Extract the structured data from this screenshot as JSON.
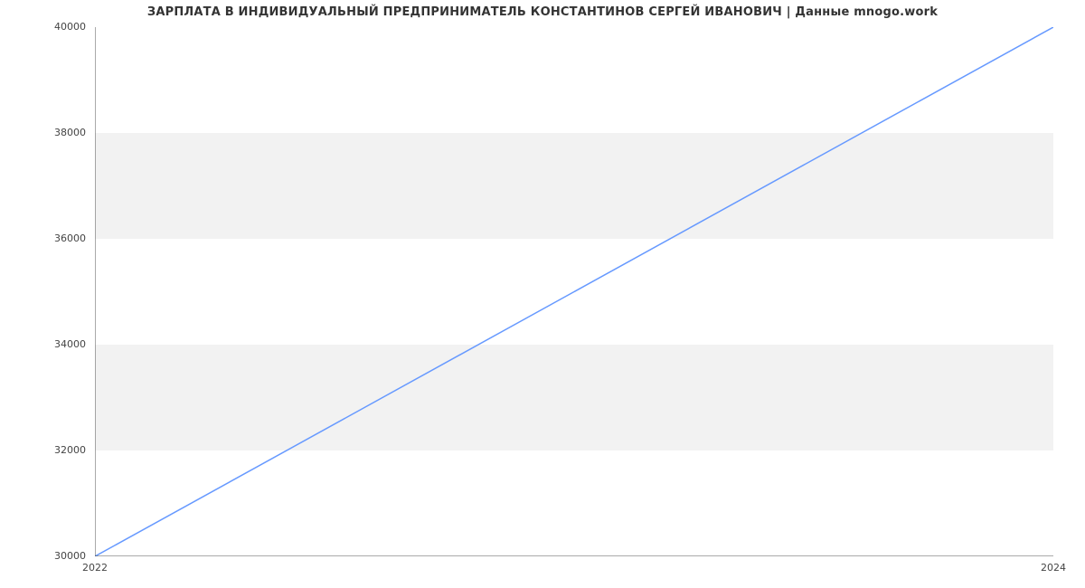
{
  "chart_data": {
    "type": "line",
    "title": "ЗАРПЛАТА В ИНДИВИДУАЛЬНЫЙ ПРЕДПРИНИМАТЕЛЬ КОНСТАНТИНОВ СЕРГЕЙ ИВАНОВИЧ | Данные mnogo.work",
    "x": [
      2022,
      2024
    ],
    "values": [
      30000,
      40000
    ],
    "xlabel": "",
    "ylabel": "",
    "xlim": [
      2022,
      2024
    ],
    "ylim": [
      30000,
      40000
    ],
    "xticks": [
      2022,
      2024
    ],
    "yticks": [
      30000,
      32000,
      34000,
      36000,
      38000,
      40000
    ],
    "bands": [
      [
        32000,
        34000
      ],
      [
        36000,
        38000
      ]
    ],
    "line_color": "#6699ff"
  }
}
